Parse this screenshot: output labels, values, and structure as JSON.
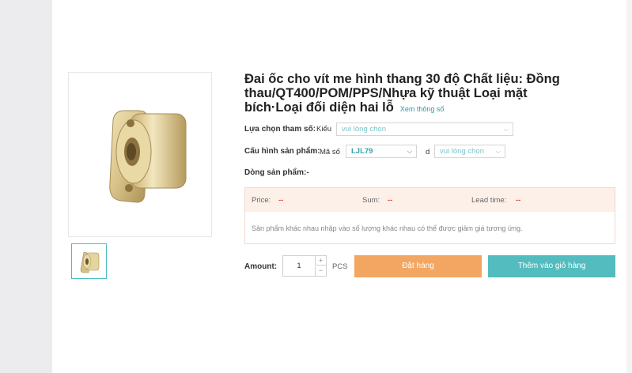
{
  "product": {
    "title": "Đai ốc cho vít me hình thang 30 độ Chất liệu: Đồng thau/QT400/POM/PPS/Nhựa kỹ thuật Loại mặt bích·Loại đối diện hai lỗ",
    "spec_link": "Xem thông số",
    "image_icon": "brass-flanged-nut-image",
    "thumb_icon": "brass-flanged-nut-thumbnail"
  },
  "params": {
    "label": "Lựa chọn tham số:",
    "type_prefix": "Kiểu",
    "type_value": "vui lòng chọn"
  },
  "config": {
    "label": "Cấu hình sản phẩm:",
    "code_prefix": "Mã số",
    "code_value": "LJL79",
    "d_prefix": "d",
    "d_value": "vui lòng chọn"
  },
  "product_line": {
    "label": "Dòng sản phẩm:",
    "value": "-"
  },
  "pricing": {
    "price_label": "Price:",
    "price_value": "--",
    "sum_label": "Sum:",
    "sum_value": "--",
    "lead_label": "Lead time:",
    "lead_value": "--",
    "note": "Sản phẩm khác nhau nhập vào số lượng khác nhau có thể được giảm giá tương ứng."
  },
  "order": {
    "amount_label": "Amount:",
    "quantity": "1",
    "plus": "+",
    "minus": "−",
    "unit": "PCS",
    "order_button": "Đặt hàng",
    "cart_button": "Thêm vào giỏ hàng"
  },
  "colors": {
    "accent_teal": "#52bcbe",
    "order_orange": "#f2a662",
    "price_dash_red": "#e2463a"
  }
}
